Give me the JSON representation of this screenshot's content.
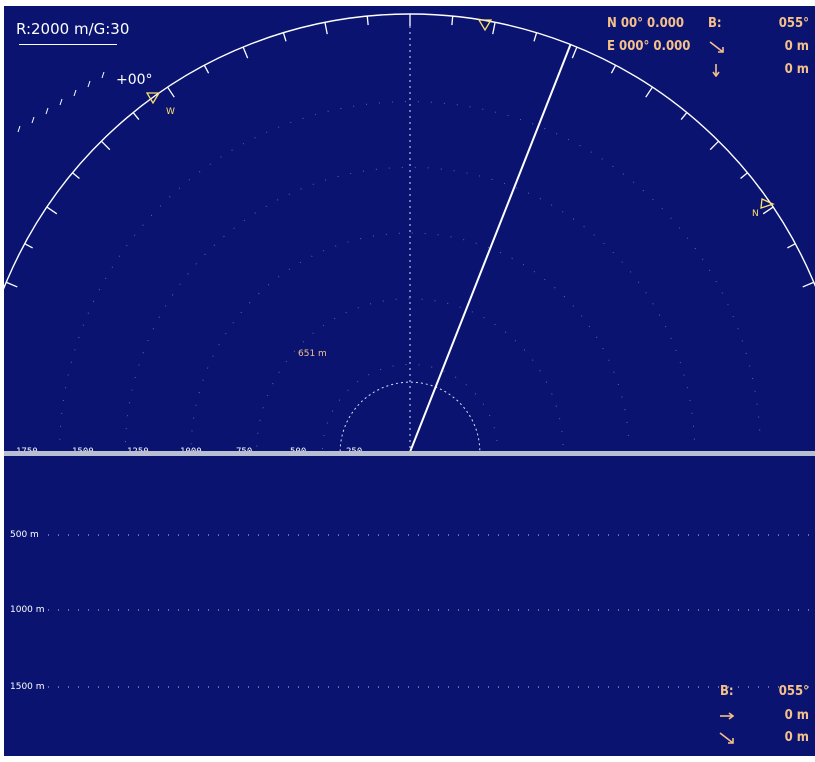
{
  "header": {
    "range_gain": "R:2000 m/G:30",
    "tilt": "+00°"
  },
  "position": {
    "lat": "N  00° 0.000",
    "lon": "E 000° 0.000"
  },
  "top_readout": {
    "bearing_label": "B:",
    "bearing_value": "055°",
    "horizontal_icon": "slant-down-arrow-icon",
    "horizontal_value": "0 m",
    "depth_icon": "down-arrow-icon",
    "depth_value": "0 m"
  },
  "compass": {
    "west_letter": "W",
    "north_letter": "N"
  },
  "scale_labels": [
    "1750",
    "1500",
    "1250",
    "1000",
    "750",
    "500",
    "250"
  ],
  "ring_label": "651 m",
  "vertical_view": {
    "depth_labels": [
      "500 m",
      "1000 m",
      "1500 m"
    ]
  },
  "bottom_readout": {
    "bearing_label": "B:",
    "bearing_value": "055°",
    "horizontal_icon": "right-arrow-icon",
    "horizontal_value": "0 m",
    "slant_icon": "slant-down-arrow-icon",
    "slant_value": "0 m"
  },
  "sonar_state": {
    "bearing_deg": 55,
    "max_range_m": 2000,
    "ring_range_m": 651
  },
  "colors": {
    "background": "#0a1470",
    "text_readout": "#f5c089",
    "marker": "#ffe06a",
    "line": "#ffffff"
  }
}
